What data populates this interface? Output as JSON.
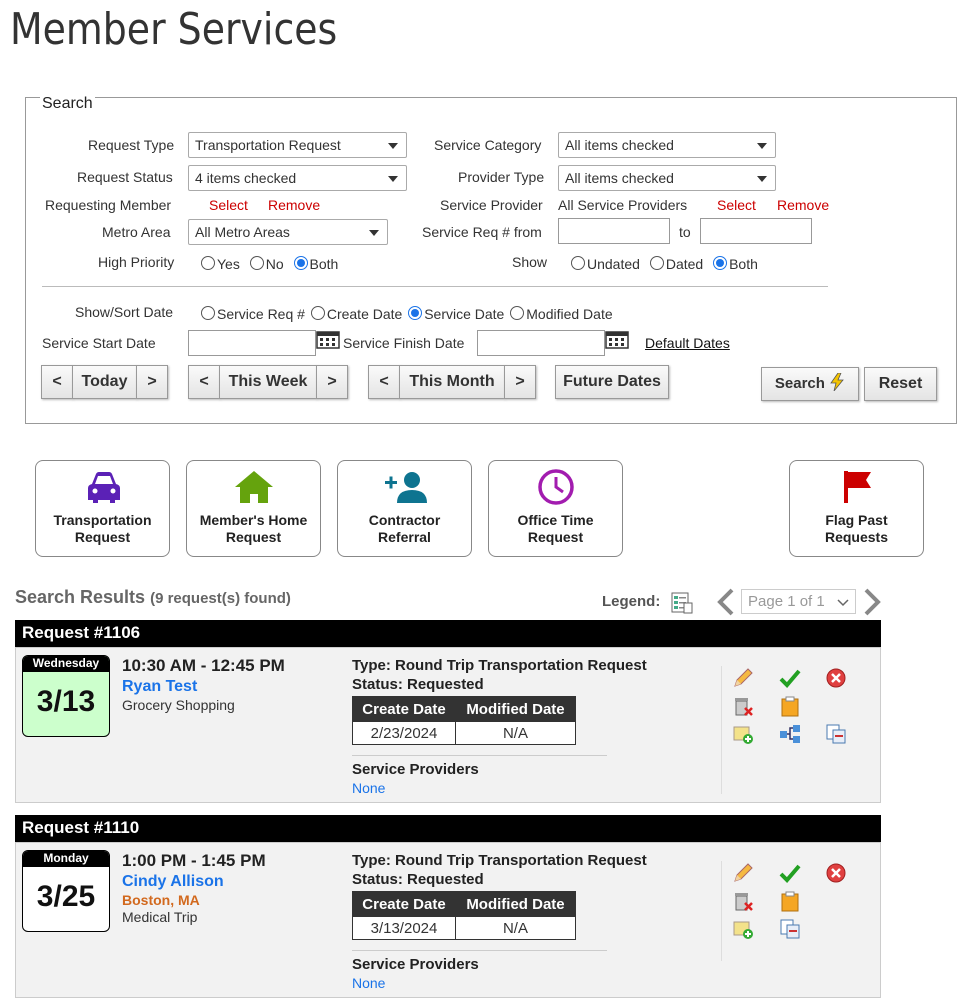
{
  "page": {
    "title": "Member Services"
  },
  "search": {
    "legend": "Search",
    "request_type_label": "Request Type",
    "request_type_value": "Transportation Request",
    "service_category_label": "Service Category",
    "service_category_value": "All items checked",
    "request_status_label": "Request Status",
    "request_status_value": "4 items checked",
    "provider_type_label": "Provider Type",
    "provider_type_value": "All items checked",
    "requesting_member_label": "Requesting Member",
    "select_label": "Select",
    "remove_label": "Remove",
    "service_provider_label": "Service Provider",
    "service_provider_value": "All Service Providers",
    "metro_area_label": "Metro Area",
    "metro_area_value": "All Metro Areas",
    "service_req_from_label": "Service Req # from",
    "to_label": "to",
    "high_priority_label": "High Priority",
    "hp_yes": "Yes",
    "hp_no": "No",
    "hp_both": "Both",
    "show_label": "Show",
    "show_undated": "Undated",
    "show_dated": "Dated",
    "show_both": "Both",
    "show_sort_label": "Show/Sort Date",
    "sort_service_req": "Service Req #",
    "sort_create": "Create Date",
    "sort_service": "Service Date",
    "sort_modified": "Modified Date",
    "start_date_label": "Service Start Date",
    "finish_date_label": "Service Finish Date",
    "default_dates": "Default Dates",
    "today": "Today",
    "this_week": "This Week",
    "this_month": "This Month",
    "future_dates": "Future Dates",
    "search_btn": "Search",
    "reset_btn": "Reset",
    "prev": "<",
    "next": ">"
  },
  "cards": [
    {
      "line1": "Transportation",
      "line2": "Request",
      "icon": "car-icon",
      "color": "#5b21b6"
    },
    {
      "line1": "Member's Home",
      "line2": "Request",
      "icon": "home-icon",
      "color": "#65a30d"
    },
    {
      "line1": "Contractor",
      "line2": "Referral",
      "icon": "add-person-icon",
      "color": "#0e7490"
    },
    {
      "line1": "Office Time",
      "line2": "Request",
      "icon": "clock-icon",
      "color": "#a21caf"
    },
    {
      "line1": "Flag Past",
      "line2": "Requests",
      "icon": "flag-icon",
      "color": "#cc0000"
    }
  ],
  "results": {
    "title": "Search Results",
    "count": "(9 request(s) found)",
    "legend_label": "Legend:",
    "page_label": "Page 1 of 1"
  },
  "requests": [
    {
      "header": "Request #1106",
      "day": "Wednesday",
      "date": "3/13",
      "time": "10:30 AM - 12:45 PM",
      "member": "Ryan Test",
      "location": "",
      "purpose": "Grocery Shopping",
      "type": "Type: Round Trip Transportation Request",
      "status": "Status:  Requested",
      "create_h": "Create Date",
      "modified_h": "Modified Date",
      "create": "2/23/2024",
      "modified": "N/A",
      "providers_h": "Service Providers",
      "providers": "None"
    },
    {
      "header": "Request #1110",
      "day": "Monday",
      "date": "3/25",
      "time": "1:00 PM - 1:45 PM",
      "member": "Cindy Allison",
      "location": "Boston, MA",
      "purpose": "Medical Trip",
      "type": "Type: Round Trip Transportation Request",
      "status": "Status:  Requested",
      "create_h": "Create Date",
      "modified_h": "Modified Date",
      "create": "3/13/2024",
      "modified": "N/A",
      "providers_h": "Service Providers",
      "providers": "None"
    }
  ]
}
